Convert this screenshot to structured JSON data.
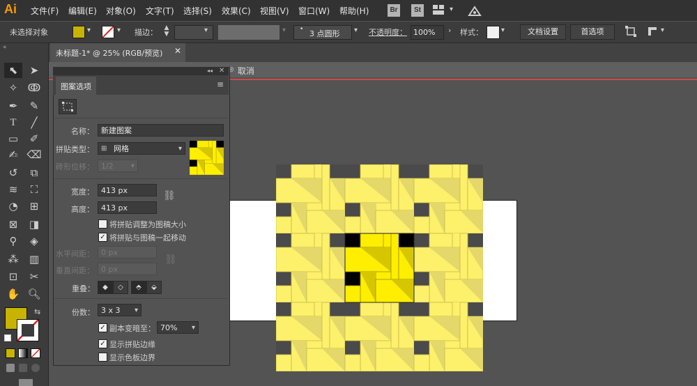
{
  "app": {
    "logo": "Ai"
  },
  "menu": {
    "items": [
      "文件(F)",
      "编辑(E)",
      "对象(O)",
      "文字(T)",
      "选择(S)",
      "效果(C)",
      "视图(V)",
      "窗口(W)",
      "帮助(H)"
    ],
    "br": "Br",
    "st": "St"
  },
  "control": {
    "selection": "未选择对象",
    "fill_color": "#c8b400",
    "stroke_label": "描边：",
    "brush": "3 点圆形",
    "opacity_label": "不透明度：",
    "opacity": "100%",
    "style_label": "样式：",
    "doc_settings": "文档设置",
    "preferences": "首选项"
  },
  "document": {
    "tab_title": "未标题-1* @ 25% (RGB/预览)",
    "cancel_label": "取消"
  },
  "panel": {
    "title": "图案选项",
    "name_label": "名称：",
    "name_value": "新建图案",
    "tile_type_label": "拼贴类型：",
    "tile_type_value": "网格",
    "brick_offset_label": "砖形位移：",
    "brick_offset_value": "1/2",
    "width_label": "宽度：",
    "width_value": "413 px",
    "height_label": "高度：",
    "height_value": "413 px",
    "opt_resize": "将拼贴调整为图稿大小",
    "opt_move": "将拼贴与图稿一起移动",
    "opt_resize_checked": false,
    "opt_move_checked": true,
    "h_spacing_label": "水平间距：",
    "h_spacing_value": "0 px",
    "v_spacing_label": "垂直间距：",
    "v_spacing_value": "0 px",
    "overlap_label": "重叠：",
    "copies_label": "份数：",
    "copies_value": "3 x 3",
    "dim_label": "副本变暗至：",
    "dim_value": "70%",
    "dim_checked": true,
    "show_tile_edge": "显示拼贴边缘",
    "show_tile_edge_checked": true,
    "show_swatch_bounds": "显示色板边界",
    "show_swatch_bounds_checked": false
  },
  "colors": {
    "accent_yellow": "#ffee00",
    "dim_yellow": "#fdf06a",
    "dark_gray": "#4a4a4a",
    "fill_swatch": "#c8b400"
  }
}
